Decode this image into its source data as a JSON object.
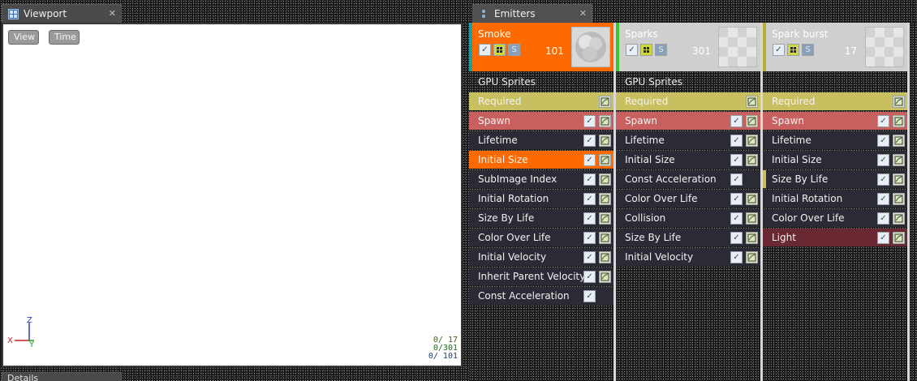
{
  "tabs": {
    "viewport": "Viewport",
    "emitters": "Emitters",
    "details": "Details",
    "close_glyph": "✕"
  },
  "viewport": {
    "view_button": "View",
    "time_button": "Time",
    "axes": {
      "z": "Z",
      "x": "X",
      "y": "Y"
    },
    "counts": [
      "0/  17",
      "0/301",
      "0/ 101"
    ]
  },
  "emitters": [
    {
      "name": "Smoke",
      "count": "101",
      "type_data": "GPU Sprites",
      "stripe_color": "#1aa0a0",
      "active": true,
      "modules": [
        {
          "label": "Required",
          "kind": "req",
          "check": false
        },
        {
          "label": "Spawn",
          "kind": "spawn",
          "check": true
        },
        {
          "label": "Lifetime",
          "kind": "norm",
          "check": true
        },
        {
          "label": "Initial Size",
          "kind": "active",
          "check": true
        },
        {
          "label": "SubImage Index",
          "kind": "norm",
          "check": true
        },
        {
          "label": "Initial Rotation",
          "kind": "norm",
          "check": true
        },
        {
          "label": "Size By Life",
          "kind": "norm",
          "check": true
        },
        {
          "label": "Color Over Life",
          "kind": "norm",
          "check": true
        },
        {
          "label": "Initial Velocity",
          "kind": "norm",
          "check": true
        },
        {
          "label": "Inherit Parent Velocity",
          "kind": "norm",
          "check": true
        },
        {
          "label": "Const Acceleration",
          "kind": "norm",
          "check": true,
          "nograph": true
        }
      ]
    },
    {
      "name": "Sparks",
      "count": "301",
      "type_data": "GPU Sprites",
      "stripe_color": "#3ac830",
      "active": false,
      "modules": [
        {
          "label": "Required",
          "kind": "req",
          "check": false
        },
        {
          "label": "Spawn",
          "kind": "spawn",
          "check": true
        },
        {
          "label": "Lifetime",
          "kind": "norm",
          "check": true
        },
        {
          "label": "Initial Size",
          "kind": "norm",
          "check": true
        },
        {
          "label": "Const Acceleration",
          "kind": "norm",
          "check": true,
          "nograph": true
        },
        {
          "label": "Color Over Life",
          "kind": "norm",
          "check": true
        },
        {
          "label": "Collision",
          "kind": "norm",
          "check": true
        },
        {
          "label": "Size By Life",
          "kind": "norm",
          "check": true
        },
        {
          "label": "Initial Velocity",
          "kind": "norm",
          "check": true
        }
      ]
    },
    {
      "name": "Spark burst",
      "count": "17",
      "type_data": "",
      "stripe_color": "#b8b030",
      "active": false,
      "modules": [
        {
          "label": "Required",
          "kind": "req",
          "check": false
        },
        {
          "label": "Spawn",
          "kind": "spawn",
          "check": true
        },
        {
          "label": "Lifetime",
          "kind": "norm",
          "check": true
        },
        {
          "label": "Initial Size",
          "kind": "norm",
          "check": true
        },
        {
          "label": "Size By Life",
          "kind": "norm",
          "check": true,
          "marked": true
        },
        {
          "label": "Initial Rotation",
          "kind": "norm",
          "check": true
        },
        {
          "label": "Color Over Life",
          "kind": "norm",
          "check": true
        },
        {
          "label": "Light",
          "kind": "light",
          "check": true
        }
      ]
    }
  ],
  "colors": {
    "accent_orange": "#ff6a00",
    "required_yellow": "#c8c060",
    "spawn_red": "#c86060",
    "module_dark": "#2b2b36"
  }
}
